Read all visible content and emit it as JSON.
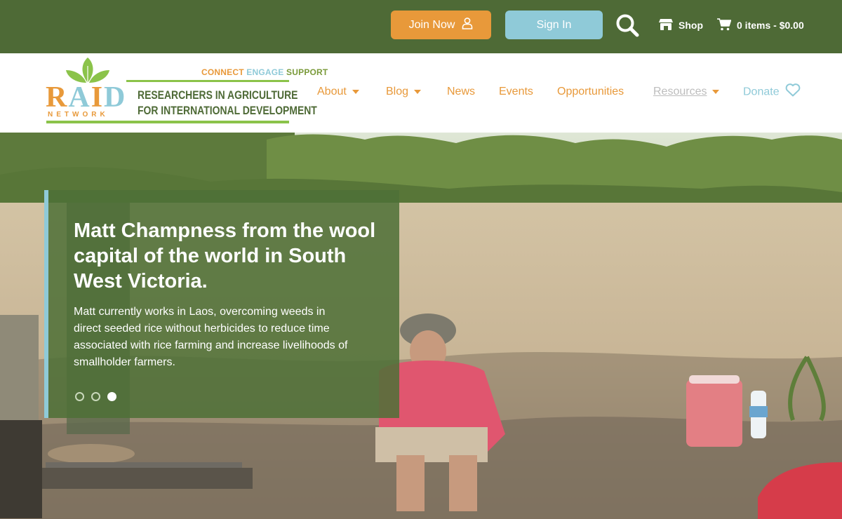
{
  "topbar": {
    "join_label": "Join Now",
    "signin_label": "Sign In",
    "shop_label": "Shop",
    "cart_label": "0 items - $0.00"
  },
  "logo": {
    "tagline_connect": "CONNECT",
    "tagline_engage": "ENGAGE",
    "tagline_support": "SUPPORT",
    "raid": "RAID",
    "network": "NETWORK",
    "line1": "RESEARCHERS IN AGRICULTURE",
    "line2": "FOR INTERNATIONAL DEVELOPMENT"
  },
  "nav": {
    "items": [
      {
        "label": "About"
      },
      {
        "label": "Blog"
      },
      {
        "label": "News"
      },
      {
        "label": "Events"
      },
      {
        "label": "Opportunities"
      },
      {
        "label": "Resources"
      },
      {
        "label": "Donate"
      }
    ]
  },
  "hero": {
    "title": "Matt Champness from the wool capital of the world in South West Victoria.",
    "body": "Matt currently works in Laos, overcoming weeds in direct seeded rice without herbicides to reduce time associated with rice farming and increase livelihoods of smallholder farmers.",
    "slides_total": 3,
    "slide_active": 3
  },
  "colors": {
    "brand_green": "#4e6a36",
    "accent_orange": "#e8993a",
    "accent_blue": "#8fcad8",
    "leaf_green": "#8bc34a"
  },
  "icons": {
    "join": "user-icon",
    "search": "search-icon",
    "shop": "store-icon",
    "cart": "cart-icon",
    "donate": "heart-icon"
  }
}
